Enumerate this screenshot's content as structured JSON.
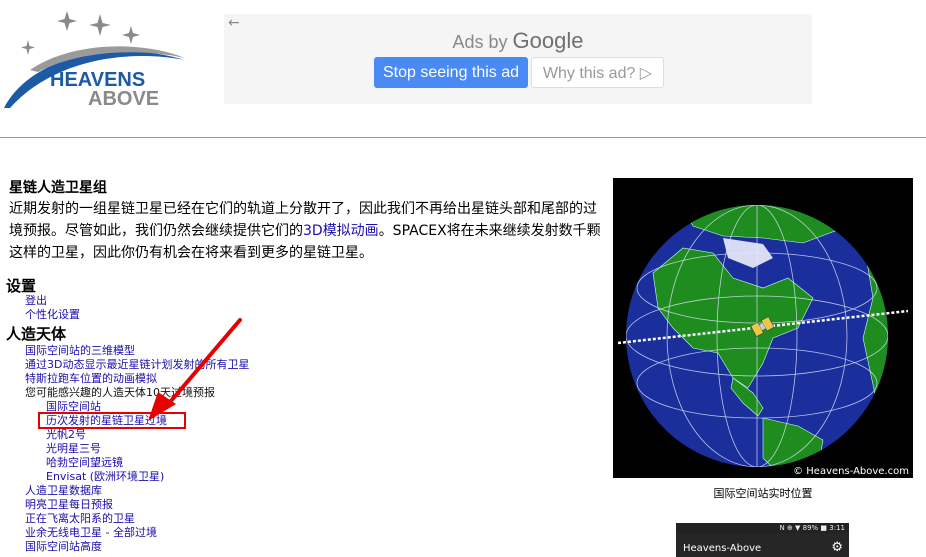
{
  "header": {
    "logo": {
      "line1": "HEAVENS",
      "line2": "ABOVE"
    },
    "ad": {
      "back_glyph": "←",
      "ads_by": "Ads by",
      "google": "Google",
      "stop_label": "Stop seeing this ad",
      "why_label": "Why this ad? ▷"
    }
  },
  "article": {
    "title": "星链人造卫星组",
    "text_before": "近期发射的一组星链卫星已经在它们的轨道上分散开了，因此我们不再给出星链头部和尾部的过境预报。尽管如此，我们仍然会继续提供它们的",
    "link": "3D模拟动画",
    "text_after": "。SPACEX将在未来继续发射数千颗这样的卫星，因此你仍有机会在将来看到更多的星链卫星。"
  },
  "settings": {
    "heading": "设置",
    "items": [
      "登出",
      "个性化设置"
    ]
  },
  "satellites": {
    "heading": "人造天体",
    "items": [
      {
        "label": "国际空间站的三维模型",
        "level": 1
      },
      {
        "label": "通过3D动态显示最近星链计划发射的所有卫星",
        "level": 1
      },
      {
        "label": "特斯拉跑车位置的动画模拟",
        "level": 1
      },
      {
        "label": "您可能感兴趣的人造天体10天过境预报",
        "level": 1,
        "plain": true
      },
      {
        "label": "国际空间站",
        "level": 2
      },
      {
        "label": "历次发射的星链卫星过境",
        "level": 2
      },
      {
        "label": "光帆2号",
        "level": 2
      },
      {
        "label": "光明星三号",
        "level": 2
      },
      {
        "label": "哈勃空间望远镜",
        "level": 2
      },
      {
        "label": "Envisat (欧洲环境卫星)",
        "level": 2
      },
      {
        "label": "人造卫星数据库",
        "level": 1
      },
      {
        "label": "明亮卫星每日预报",
        "level": 1
      },
      {
        "label": "正在飞离太阳系的卫星",
        "level": 1
      },
      {
        "label": "业余无线电卫星 - 全部过境",
        "level": 1
      },
      {
        "label": "国际空间站高度",
        "level": 1
      }
    ]
  },
  "globe": {
    "copyright": "© Heavens-Above.com",
    "caption": "国际空间站实时位置"
  },
  "phone": {
    "status": "N ⊕ ▼ 89% ■ 3:11",
    "app_name": "Heavens-Above",
    "gear": "⚙"
  },
  "colors": {
    "link": "#1a0dab",
    "ad_button": "#4a8af4",
    "highlight": "#e60000",
    "ocean": "#1a2f9c",
    "land": "#1f8c1f",
    "logo_blue": "#1c5aa6"
  }
}
